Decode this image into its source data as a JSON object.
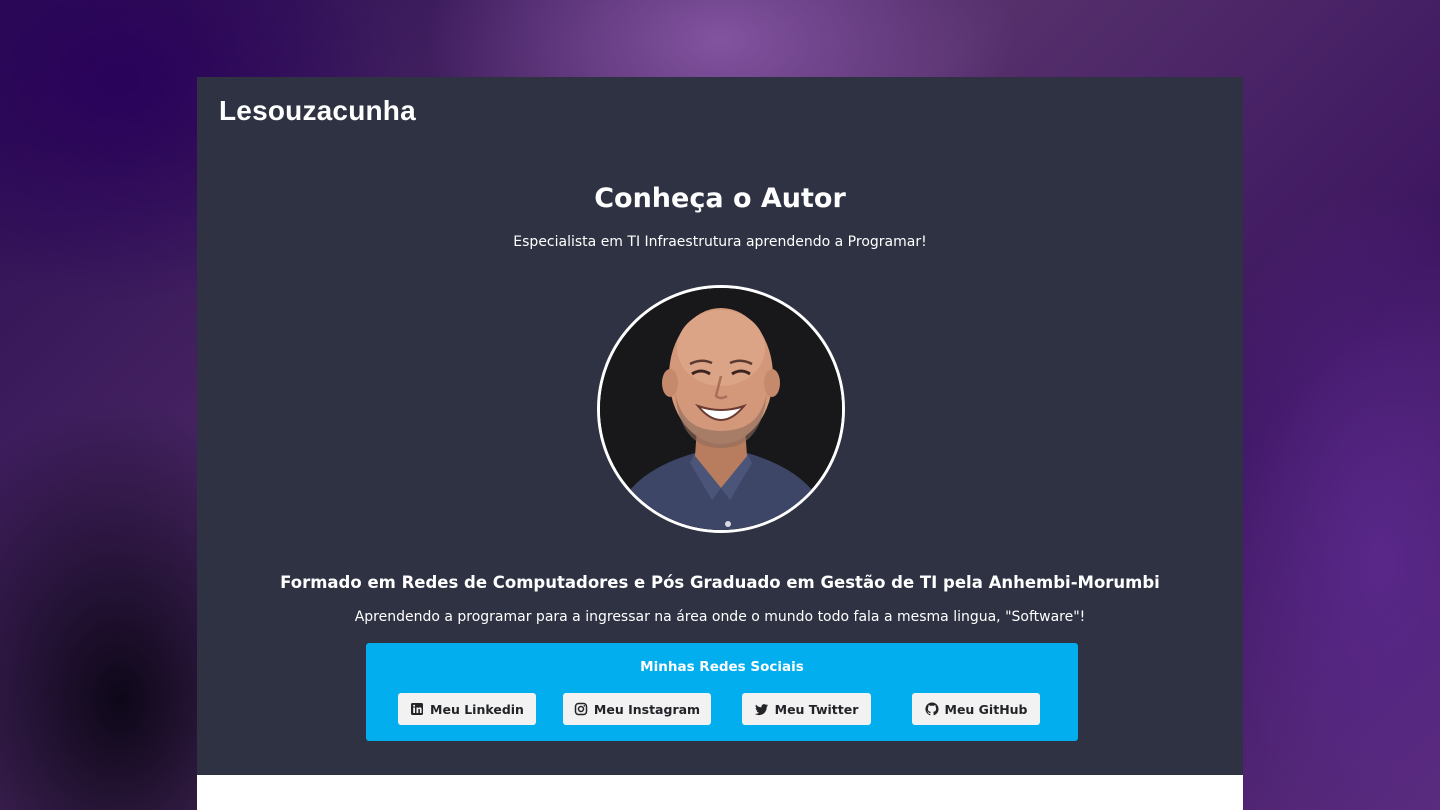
{
  "header": {
    "brand": "Lesouzacunha"
  },
  "hero": {
    "title": "Conheça o Autor",
    "subtitle": "Especialista em TI Infraestrutura aprendendo a Programar!",
    "headline": "Formado em Redes de Computadores e Pós Graduado em Gestão de TI pela Anhembi-Morumbi",
    "description": "Aprendendo a programar para a ingressar na área onde o mundo todo fala a mesma lingua, \"Software\"!"
  },
  "social": {
    "title": "Minhas Redes Sociais",
    "links": [
      {
        "label": "Meu Linkedin",
        "icon": "linkedin-icon"
      },
      {
        "label": "Meu Instagram",
        "icon": "instagram-icon"
      },
      {
        "label": "Meu Twitter",
        "icon": "twitter-icon"
      },
      {
        "label": "Meu GitHub",
        "icon": "github-icon"
      }
    ]
  },
  "colors": {
    "hero_bg": "#2e3242",
    "social_bg": "#03aeef",
    "button_bg": "#f2f2f2",
    "text": "#ffffff"
  }
}
